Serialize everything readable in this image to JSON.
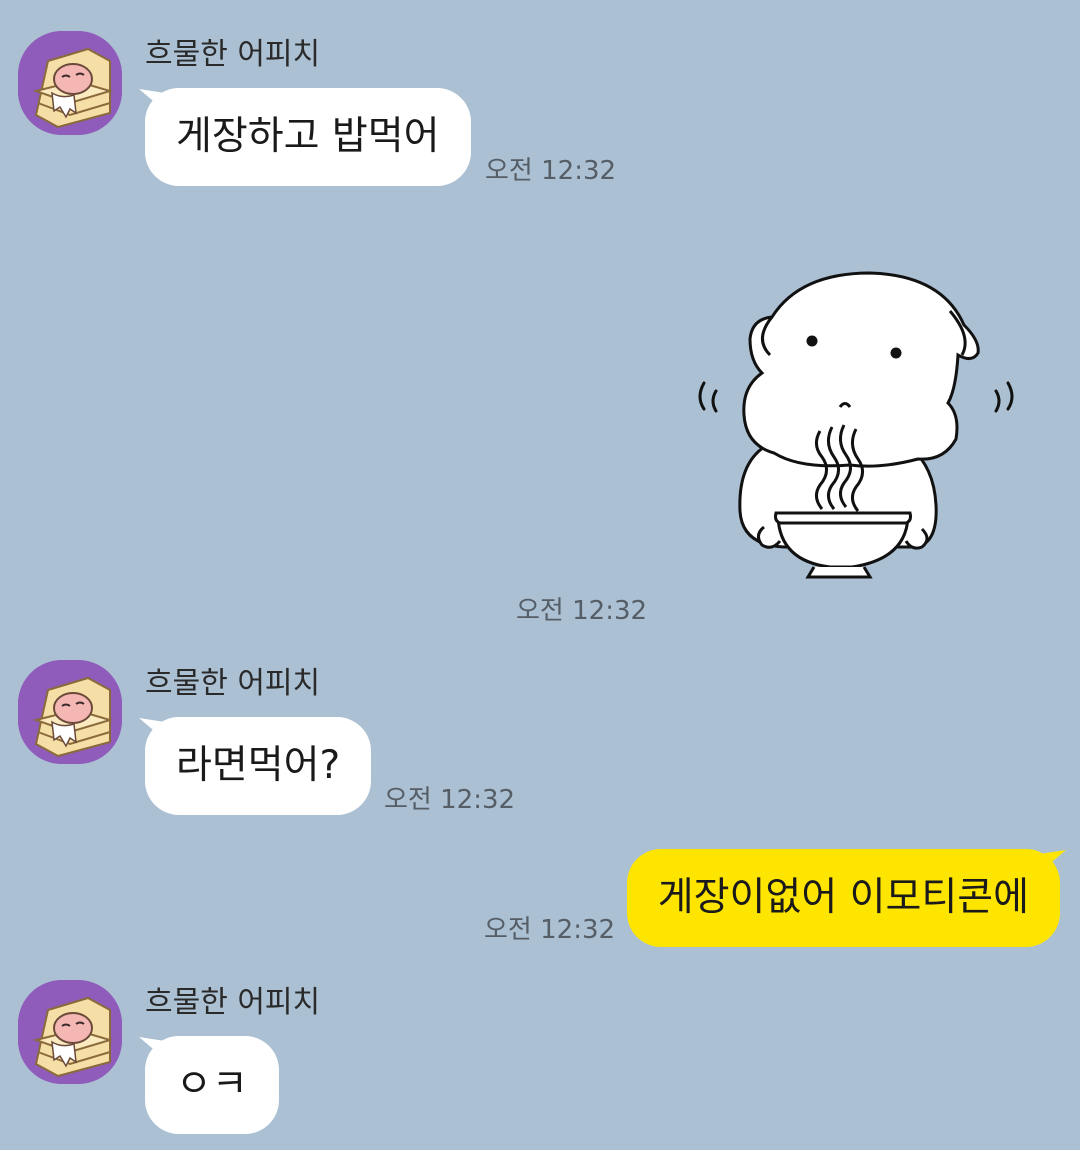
{
  "chat": {
    "messages": [
      {
        "sender": "흐물한 어피치",
        "text": "게장하고 밥먹어",
        "time": "오전 12:32"
      },
      {
        "sender": "me",
        "sticker": "white-dog-eating-noodles",
        "time": "오전 12:32"
      },
      {
        "sender": "흐물한 어피치",
        "text": "라면먹어?",
        "time": "오전 12:32"
      },
      {
        "sender": "me",
        "text": "게장이없어 이모티콘에",
        "time": "오전 12:32"
      },
      {
        "sender": "흐물한 어피치",
        "text": "ㅇㅋ"
      }
    ]
  },
  "colors": {
    "background": "#abc0d3",
    "incoming_bubble": "#ffffff",
    "outgoing_bubble": "#fee500",
    "avatar_bg": "#8f5cbc"
  }
}
